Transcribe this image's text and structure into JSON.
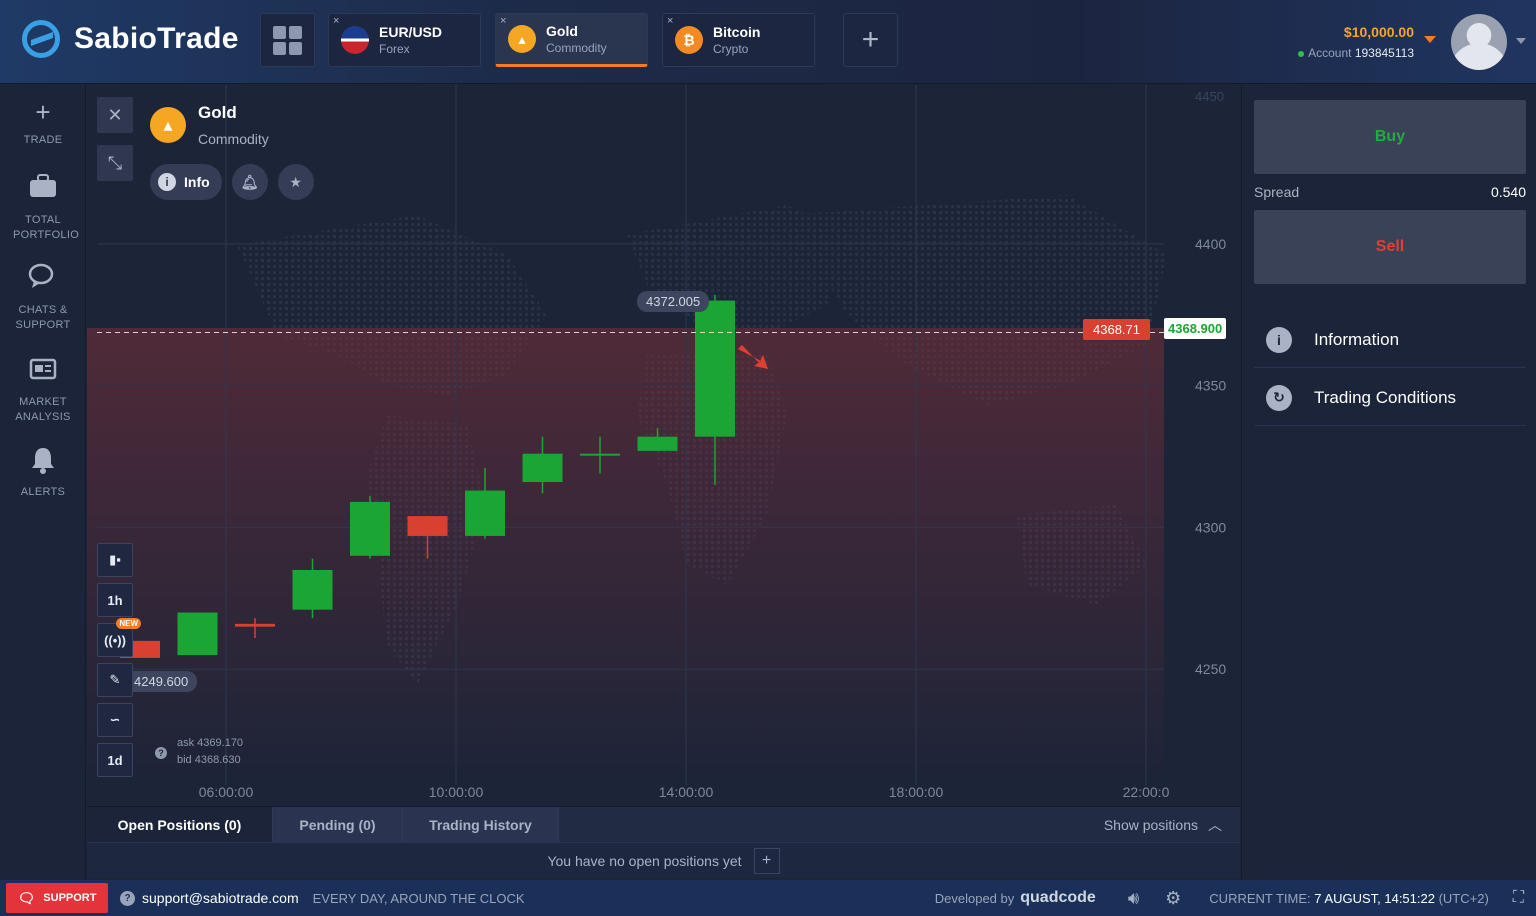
{
  "app": {
    "brand": "SabioTrade"
  },
  "header": {
    "tabs": [
      {
        "name": "EUR/USD",
        "sub": "Forex",
        "icon": "us-eu-flag-icon",
        "close": "×"
      },
      {
        "name": "Gold",
        "sub": "Commodity",
        "icon": "gold-bars-icon",
        "close": "×",
        "active": true
      },
      {
        "name": "Bitcoin",
        "sub": "Crypto",
        "icon": "bitcoin-icon",
        "close": "×"
      }
    ],
    "add_tab": "+",
    "balance": "$10,000.00",
    "account_label": "Account",
    "account_number": "193845113"
  },
  "sidebar": {
    "items": [
      {
        "label": "TRADE",
        "icon": "plus-icon"
      },
      {
        "label": "TOTAL PORTFOLIO",
        "icon": "briefcase-icon"
      },
      {
        "label": "CHATS & SUPPORT",
        "icon": "chat-bubbles-icon"
      },
      {
        "label": "MARKET ANALYSIS",
        "icon": "news-icon"
      },
      {
        "label": "ALERTS",
        "icon": "bell-icon"
      }
    ]
  },
  "chart": {
    "asset_name": "Gold",
    "asset_type": "Commodity",
    "info_label": "Info",
    "peak_label": "4372.005",
    "low_label": "4249.600",
    "current_red": "4368.71",
    "current_white": "4368.900",
    "timeframe_top": "1h",
    "timeframe_bottom": "1d",
    "new_badge": "NEW",
    "ask_label": "ask 4369.170",
    "bid_label": "bid 4368.630",
    "top_axis_label": "4450",
    "colors": {
      "up": "#1aa534",
      "down": "#d8412f",
      "accent": "#f57c1f"
    }
  },
  "chart_data": {
    "type": "candlestick",
    "y_ticks": [
      4400,
      4350,
      4300,
      4250
    ],
    "x_ticks": [
      "06:00:00",
      "10:00:00",
      "14:00:00",
      "18:00:00",
      "22:00:0"
    ],
    "ylim": [
      4212,
      4456
    ],
    "current_price": 4368.71,
    "candles": [
      {
        "o": 4260,
        "c": 4254,
        "h": 4260,
        "l": 4254
      },
      {
        "o": 4255,
        "c": 4270,
        "h": 4270,
        "l": 4255
      },
      {
        "o": 4266,
        "c": 4265,
        "h": 4268,
        "l": 4261
      },
      {
        "o": 4271,
        "c": 4285,
        "h": 4289,
        "l": 4268
      },
      {
        "o": 4290,
        "c": 4309,
        "h": 4311,
        "l": 4289
      },
      {
        "o": 4304,
        "c": 4297,
        "h": 4304,
        "l": 4289
      },
      {
        "o": 4297,
        "c": 4313,
        "h": 4321,
        "l": 4296
      },
      {
        "o": 4316,
        "c": 4326,
        "h": 4332,
        "l": 4312
      },
      {
        "o": 4326,
        "c": 4326,
        "h": 4332,
        "l": 4319
      },
      {
        "o": 4327,
        "c": 4332,
        "h": 4335,
        "l": 4327
      },
      {
        "o": 4332,
        "c": 4380,
        "h": 4382,
        "l": 4315
      }
    ]
  },
  "positions": {
    "tabs": [
      "Open Positions (0)",
      "Pending (0)",
      "Trading History"
    ],
    "show_positions": "Show positions",
    "empty_text": "You have no open positions yet",
    "add": "+"
  },
  "right_panel": {
    "buy_label": "Buy",
    "sell_label": "Sell",
    "spread_label": "Spread",
    "spread_value": "0.540",
    "links": [
      {
        "label": "Information",
        "icon": "info-circle-icon"
      },
      {
        "label": "Trading Conditions",
        "icon": "refresh-conditions-icon"
      }
    ]
  },
  "footer": {
    "support_label": "SUPPORT",
    "email": "support@sabiotrade.com",
    "hours": "EVERY DAY, AROUND THE CLOCK",
    "developed_by": "Developed by",
    "developer": "quadcode",
    "time_label": "CURRENT TIME:",
    "time_value": "7 AUGUST, 14:51:22",
    "timezone": "(UTC+2)"
  }
}
